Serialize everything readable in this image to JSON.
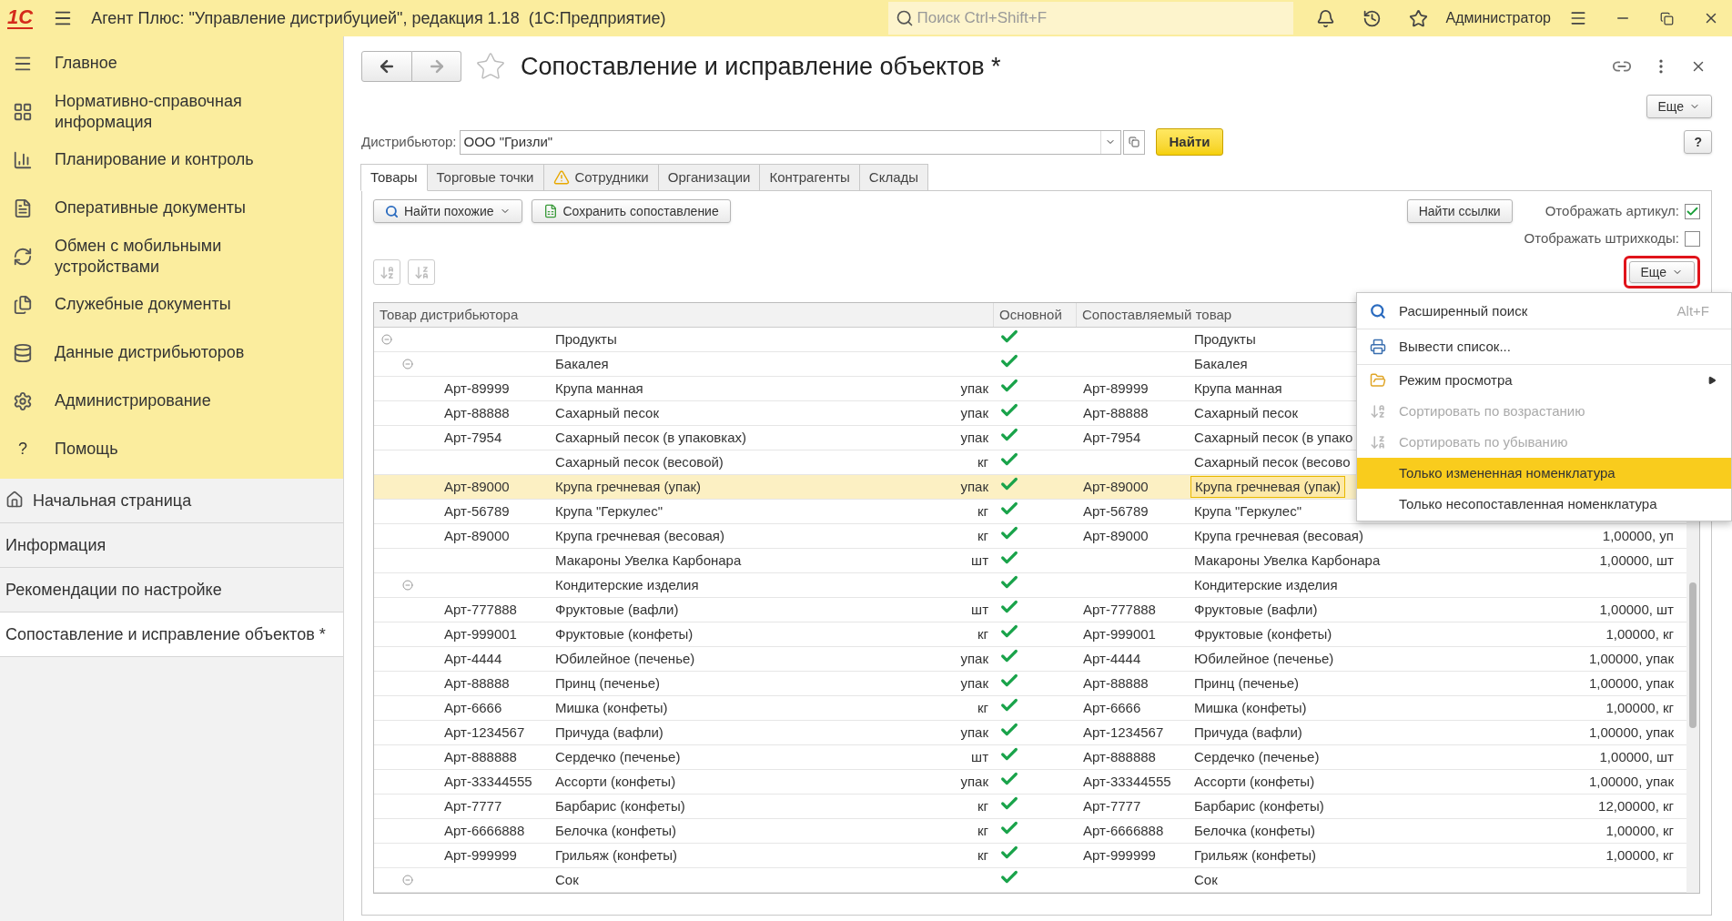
{
  "app_bar": {
    "logo": "1С",
    "title": "Агент Плюс: \"Управление дистрибуцией\", редакция 1.18  (1С:Предприятие)",
    "search_placeholder": "Поиск Ctrl+Shift+F",
    "user": "Администратор"
  },
  "sidebar": {
    "sections": [
      {
        "label": "Главное"
      },
      {
        "label": "Нормативно-справочная информация"
      },
      {
        "label": "Планирование и контроль"
      },
      {
        "label": "Оперативные документы"
      },
      {
        "label": "Обмен с мобильными устройствами"
      },
      {
        "label": "Служебные документы"
      },
      {
        "label": "Данные дистрибьюторов"
      },
      {
        "label": "Администрирование"
      },
      {
        "label": "Помощь",
        "glyph": "?"
      }
    ],
    "open_windows": [
      {
        "label": "Начальная страница",
        "kind": "home",
        "selected": false
      },
      {
        "label": "Информация",
        "kind": "page",
        "selected": false
      },
      {
        "label": "Рекомендации по настройке",
        "kind": "page",
        "selected": false
      },
      {
        "label": "Сопоставление и исправление объектов *",
        "kind": "page",
        "selected": true
      }
    ]
  },
  "form": {
    "title": "Сопоставление и исправление объектов *",
    "more_button": "Еще",
    "help_button": "?",
    "distributor_label": "Дистрибьютор:",
    "distributor_value": "ООО \"Гризли\"",
    "find_button": "Найти",
    "tabs": [
      {
        "label": "Товары",
        "selected": true,
        "warning": false
      },
      {
        "label": "Торговые точки",
        "selected": false,
        "warning": false
      },
      {
        "label": "Сотрудники",
        "selected": false,
        "warning": true
      },
      {
        "label": "Организации",
        "selected": false,
        "warning": false
      },
      {
        "label": "Контрагенты",
        "selected": false,
        "warning": false
      },
      {
        "label": "Склады",
        "selected": false,
        "warning": false
      }
    ],
    "find_similar": "Найти похожие",
    "save_match": "Сохранить сопоставление",
    "find_links": "Найти ссылки",
    "show_article": {
      "label": "Отображать артикул:",
      "checked": true
    },
    "show_barcodes": {
      "label": "Отображать штрихкоды:",
      "checked": false
    },
    "table_more": {
      "label": "Еще",
      "highlighted": true
    }
  },
  "table": {
    "columns": [
      "Товар дистрибьютора",
      "Основной",
      "Сопоставляемый товар"
    ],
    "rows": [
      {
        "name": "Продукты",
        "expanded": true,
        "main": true,
        "match_name": "Продукты",
        "selected": false,
        "children": [
          {
            "name": "Бакалея",
            "expanded": true,
            "main": true,
            "match_name": "Бакалея",
            "selected": false,
            "children": [
              {
                "article": "Арт-89999",
                "name": "Крупа манная",
                "unit": "упак",
                "main": true,
                "match_article": "Арт-89999",
                "match_name": "Крупа манная",
                "selected": false
              },
              {
                "article": "Арт-88888",
                "name": "Сахарный песок",
                "unit": "упак",
                "main": true,
                "match_article": "Арт-88888",
                "match_name": "Сахарный песок",
                "selected": false
              },
              {
                "article": "Арт-7954",
                "name": "Сахарный песок (в упаковках)",
                "unit": "упак",
                "main": true,
                "match_article": "Арт-7954",
                "match_name": "Сахарный песок (в упако",
                "selected": false
              },
              {
                "name": "Сахарный песок (весовой)",
                "unit": "кг",
                "main": true,
                "match_name": "Сахарный песок (весово",
                "selected": false
              },
              {
                "article": "Арт-89000",
                "name": "Крупа гречневая (упак)",
                "unit": "упак",
                "main": true,
                "match_article": "Арт-89000",
                "match_name": "Крупа гречневая (упак)",
                "selected": true
              },
              {
                "article": "Арт-56789",
                "name": "Крупа \"Геркулес\"",
                "unit": "кг",
                "main": true,
                "match_article": "Арт-56789",
                "match_name": "Крупа \"Геркулес\"",
                "selected": false
              },
              {
                "article": "Арт-89000",
                "name": "Крупа гречневая (весовая)",
                "unit": "кг",
                "main": true,
                "match_article": "Арт-89000",
                "match_name": "Крупа гречневая (весовая)",
                "match_qty": "1,00000, уп",
                "selected": false
              },
              {
                "name": "Макароны Увелка Карбонара",
                "unit": "шт",
                "main": true,
                "match_name": "Макароны Увелка Карбонара",
                "match_qty": "1,00000, шт",
                "selected": false
              }
            ]
          },
          {
            "name": "Кондитерские изделия",
            "expanded": true,
            "main": true,
            "match_name": "Кондитерские изделия",
            "selected": false,
            "children": [
              {
                "article": "Арт-777888",
                "name": "Фруктовые (вафли)",
                "unit": "шт",
                "main": true,
                "match_article": "Арт-777888",
                "match_name": "Фруктовые (вафли)",
                "match_qty": "1,00000, шт",
                "selected": false
              },
              {
                "article": "Арт-999001",
                "name": "Фруктовые (конфеты)",
                "unit": "кг",
                "main": true,
                "match_article": "Арт-999001",
                "match_name": "Фруктовые (конфеты)",
                "match_qty": "1,00000, кг",
                "selected": false
              },
              {
                "article": "Арт-4444",
                "name": "Юбилейное (печенье)",
                "unit": "упак",
                "main": true,
                "match_article": "Арт-4444",
                "match_name": "Юбилейное (печенье)",
                "match_qty": "1,00000, упак",
                "selected": false
              },
              {
                "article": "Арт-88888",
                "name": "Принц (печенье)",
                "unit": "упак",
                "main": true,
                "match_article": "Арт-88888",
                "match_name": "Принц (печенье)",
                "match_qty": "1,00000, упак",
                "selected": false
              },
              {
                "article": "Арт-6666",
                "name": "Мишка (конфеты)",
                "unit": "кг",
                "main": true,
                "match_article": "Арт-6666",
                "match_name": "Мишка (конфеты)",
                "match_qty": "1,00000, кг",
                "selected": false
              },
              {
                "article": "Арт-1234567",
                "name": "Причуда (вафли)",
                "unit": "упак",
                "main": true,
                "match_article": "Арт-1234567",
                "match_name": "Причуда (вафли)",
                "match_qty": "1,00000, упак",
                "selected": false
              },
              {
                "article": "Арт-888888",
                "name": "Сердечко (печенье)",
                "unit": "шт",
                "main": true,
                "match_article": "Арт-888888",
                "match_name": "Сердечко (печенье)",
                "match_qty": "1,00000, шт",
                "selected": false
              },
              {
                "article": "Арт-33344555",
                "name": "Ассорти (конфеты)",
                "unit": "упак",
                "main": true,
                "match_article": "Арт-33344555",
                "match_name": "Ассорти (конфеты)",
                "match_qty": "1,00000, упак",
                "selected": false
              },
              {
                "article": "Арт-7777",
                "name": "Барбарис (конфеты)",
                "unit": "кг",
                "main": true,
                "match_article": "Арт-7777",
                "match_name": "Барбарис (конфеты)",
                "match_qty": "12,00000, кг",
                "selected": false
              },
              {
                "article": "Арт-6666888",
                "name": "Белочка (конфеты)",
                "unit": "кг",
                "main": true,
                "match_article": "Арт-6666888",
                "match_name": "Белочка (конфеты)",
                "match_qty": "1,00000, кг",
                "selected": false
              },
              {
                "article": "Арт-999999",
                "name": "Грильяж (конфеты)",
                "unit": "кг",
                "main": true,
                "match_article": "Арт-999999",
                "match_name": "Грильяж (конфеты)",
                "match_qty": "1,00000, кг",
                "selected": false
              }
            ]
          },
          {
            "name": "Сок",
            "expanded": true,
            "main": true,
            "match_name": "Сок",
            "selected": false
          }
        ]
      }
    ]
  },
  "menu": {
    "items": [
      {
        "label": "Расширенный поиск",
        "shortcut": "Alt+F",
        "kind": "search",
        "disabled": false,
        "selected": false
      },
      {
        "label": "Вывести список...",
        "kind": "print",
        "disabled": false,
        "selected": false
      },
      {
        "label": "Режим просмотра",
        "kind": "submenu",
        "disabled": false,
        "selected": false
      },
      {
        "label": "Сортировать по возрастанию",
        "kind": "sort_asc",
        "disabled": true,
        "selected": false
      },
      {
        "label": "Сортировать по убыванию",
        "kind": "sort_desc",
        "disabled": true,
        "selected": false
      },
      {
        "label": "Только измененная номенклатура",
        "kind": "plain",
        "disabled": false,
        "selected": true
      },
      {
        "label": "Только несопоставленная номенклатура",
        "kind": "plain",
        "disabled": false,
        "selected": false
      }
    ]
  }
}
